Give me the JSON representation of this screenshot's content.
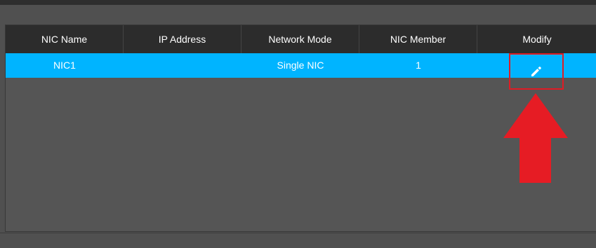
{
  "table": {
    "headers": [
      "NIC Name",
      "IP Address",
      "Network Mode",
      "NIC Member",
      "Modify"
    ],
    "rows": [
      {
        "nic_name": "NIC1",
        "ip_address": "",
        "network_mode": "Single NIC",
        "nic_member": "1"
      }
    ]
  },
  "icons": {
    "modify": "pencil-edit-icon",
    "annotation": "red-arrow-up"
  },
  "colors": {
    "header_bg": "#2c2c2c",
    "selected_row": "#00b4ff",
    "highlight": "#e01b24",
    "arrow": "#e61c24"
  }
}
